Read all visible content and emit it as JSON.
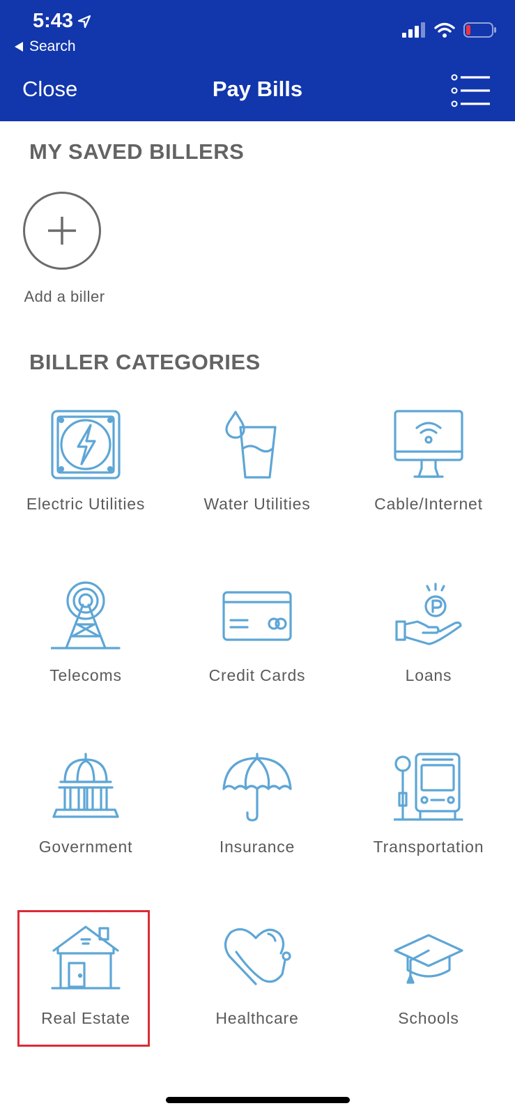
{
  "status_bar": {
    "time": "5:43",
    "back_label": "Search"
  },
  "nav": {
    "close_label": "Close",
    "title": "Pay Bills"
  },
  "saved_billers": {
    "title": "MY SAVED BILLERS",
    "add_label": "Add a biller"
  },
  "categories": {
    "title": "BILLER CATEGORIES",
    "items": [
      {
        "label": "Electric Utilities",
        "icon": "electric-utilities-icon"
      },
      {
        "label": "Water Utilities",
        "icon": "water-utilities-icon"
      },
      {
        "label": "Cable/Internet",
        "icon": "cable-internet-icon"
      },
      {
        "label": "Telecoms",
        "icon": "telecoms-icon"
      },
      {
        "label": "Credit Cards",
        "icon": "credit-card-icon"
      },
      {
        "label": "Loans",
        "icon": "loans-icon"
      },
      {
        "label": "Government",
        "icon": "government-icon"
      },
      {
        "label": "Insurance",
        "icon": "umbrella-icon"
      },
      {
        "label": "Transportation",
        "icon": "transportation-icon"
      },
      {
        "label": "Real Estate",
        "icon": "house-icon",
        "highlighted": true
      },
      {
        "label": "Healthcare",
        "icon": "healthcare-icon"
      },
      {
        "label": "Schools",
        "icon": "graduation-cap-icon"
      }
    ]
  },
  "colors": {
    "header": "#1236ac",
    "icon": "#5ea6d6",
    "text": "#5a5a5a",
    "highlight": "#dc2b35"
  }
}
